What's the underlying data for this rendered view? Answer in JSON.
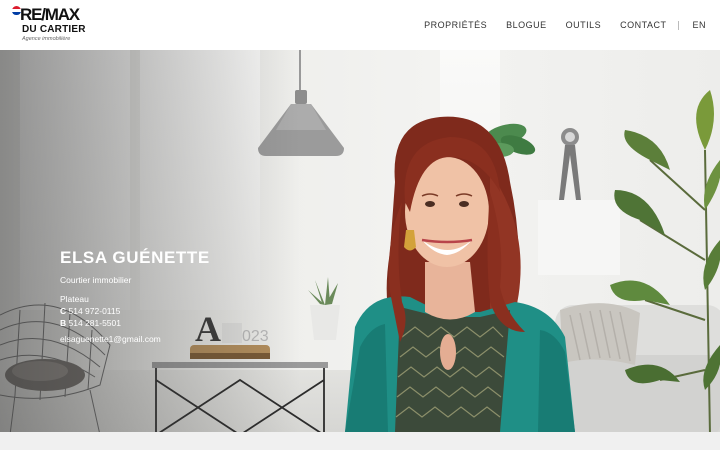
{
  "logo": {
    "brand": "RE/MAX",
    "subtitle": "DU CARTIER",
    "tagline": "Agence immobilière",
    "balloon_colors": [
      "#dc1c2e",
      "#ffffff",
      "#003da5"
    ]
  },
  "nav": {
    "items": [
      {
        "label": "PROPRIÉTÉS"
      },
      {
        "label": "BLOGUE"
      },
      {
        "label": "OUTILS"
      },
      {
        "label": "CONTACT"
      }
    ],
    "language": "EN"
  },
  "agent": {
    "name": "ELSA GUÉNETTE",
    "title": "Courtier immobilier",
    "area": "Plateau",
    "phones": [
      {
        "type": "C",
        "number": "514 972-0115"
      },
      {
        "type": "B",
        "number": "514 281-5501"
      }
    ],
    "email": "elsaguenette1@gmail.com"
  },
  "decor": {
    "table_label": "A 2023"
  },
  "colors": {
    "cardigan": "#1f8f86",
    "hair": "#8a2f1f",
    "text_on_hero": "#ffffff"
  }
}
